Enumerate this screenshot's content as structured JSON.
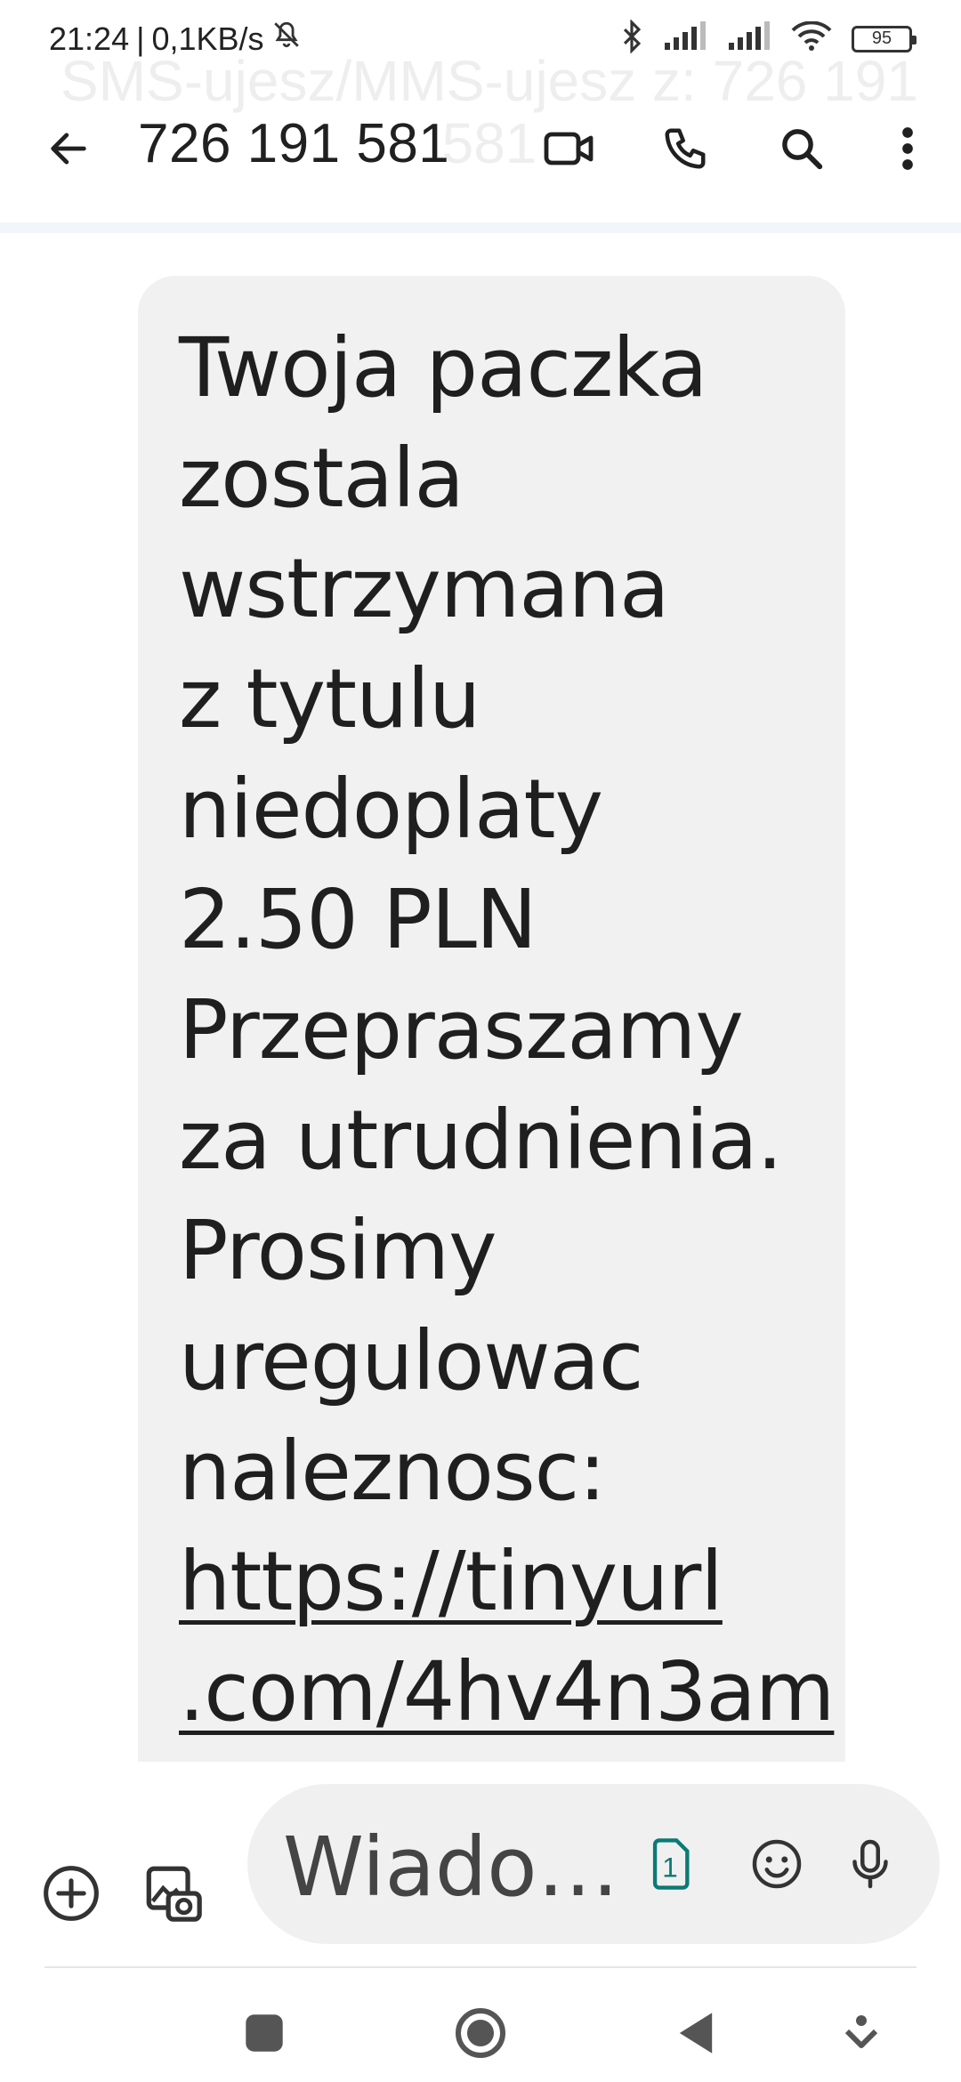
{
  "status_bar": {
    "time": "21:24",
    "separator": "|",
    "speed": "0,1KB/s",
    "battery_level": "95",
    "icons": [
      "mute-icon",
      "bluetooth-icon",
      "signal-icon",
      "signal-icon",
      "wifi-icon",
      "battery-icon"
    ]
  },
  "ghost_title": "SMS-ujesz/MMS-ujesz z: 726 191 581",
  "app_bar": {
    "title": "726 191 581",
    "actions": [
      "video-call-icon",
      "phone-icon",
      "search-icon",
      "more-vert-icon"
    ]
  },
  "message": {
    "text": "Twoja paczka\nzostala\nwstrzymana\nz tytulu\nniedoplaty\n2.50 PLN\nPrzepraszamy\nza utrudnienia.\nProsimy\nuregulowac\nnaleznosc:",
    "link": "https://tinyurl\n.com/4hv4n3am"
  },
  "composer": {
    "placeholder": "Wiado…",
    "sim_label": "1"
  },
  "colors": {
    "bubble": "#f1f1f1",
    "input": "#f0f0f0",
    "accent_sim": "#0b7a75"
  }
}
